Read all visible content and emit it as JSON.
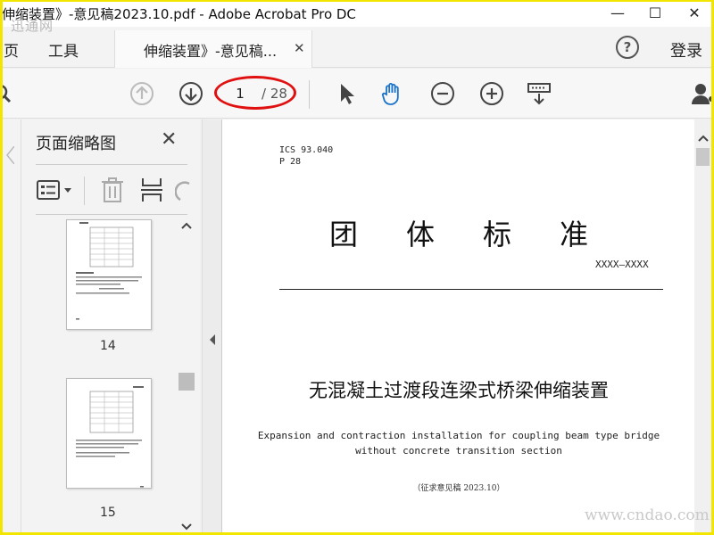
{
  "window": {
    "title": "伸缩装置》-意见稿2023.10.pdf - Adobe Acrobat Pro DC",
    "minimize": "—",
    "maximize": "☐",
    "close": "✕"
  },
  "menu": {
    "home": "页",
    "tools": "工具",
    "signin": "登录",
    "help": "?"
  },
  "tab": {
    "label": "伸缩装置》-意见稿...",
    "close": "✕"
  },
  "toolbar": {
    "current_page": "1",
    "total_pages": "/ 28"
  },
  "thumbnails": {
    "title": "页面缩略图",
    "close": "✕",
    "pages": [
      {
        "number": "14"
      },
      {
        "number": "15"
      }
    ]
  },
  "document": {
    "ics": "ICS 93.040",
    "p": "P 28",
    "main_heading": "团体标准",
    "number": "XXXX—XXXX",
    "title": "无混凝土过渡段连梁式桥梁伸缩装置",
    "english_line1": "Expansion and contraction installation for coupling beam type bridge",
    "english_line2": "without concrete transition section",
    "draft_note": "（征求意见稿 2023.10）"
  },
  "watermark": {
    "site": "www.cndao.com",
    "logo": "迅通网"
  },
  "colors": {
    "accent_blue": "#1a73c9",
    "highlight_ellipse": "#e01010",
    "frame_yellow": "#f2e600"
  }
}
